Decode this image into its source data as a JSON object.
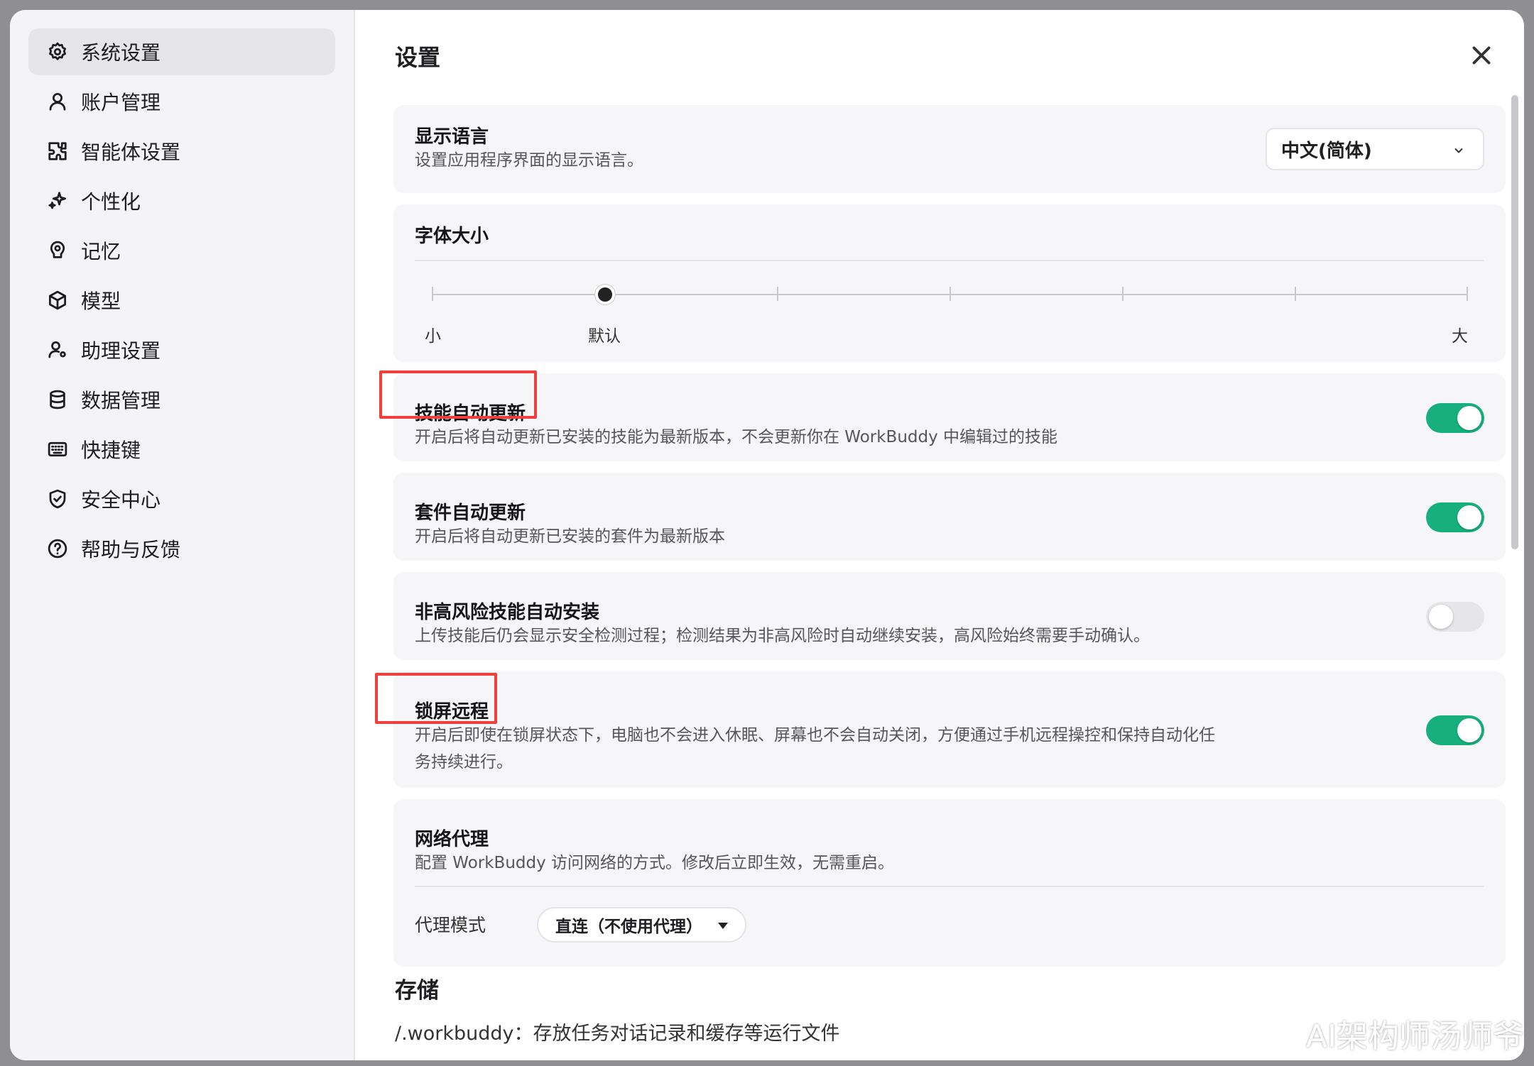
{
  "sidebar": {
    "items": [
      {
        "label": "系统设置",
        "icon": "gear-icon"
      },
      {
        "label": "账户管理",
        "icon": "user-icon"
      },
      {
        "label": "智能体设置",
        "icon": "puzzle-icon"
      },
      {
        "label": "个性化",
        "icon": "sparkle-icon"
      },
      {
        "label": "记忆",
        "icon": "memory-icon"
      },
      {
        "label": "模型",
        "icon": "cube-icon"
      },
      {
        "label": "助理设置",
        "icon": "user-gear-icon"
      },
      {
        "label": "数据管理",
        "icon": "database-icon"
      },
      {
        "label": "快捷键",
        "icon": "keyboard-icon"
      },
      {
        "label": "安全中心",
        "icon": "shield-icon"
      },
      {
        "label": "帮助与反馈",
        "icon": "help-icon"
      }
    ]
  },
  "main": {
    "title": "设置",
    "language": {
      "title": "显示语言",
      "desc": "设置应用程序界面的显示语言。",
      "value": "中文(简体)"
    },
    "font_size": {
      "title": "字体大小",
      "label_small": "小",
      "label_default": "默认",
      "label_large": "大",
      "level": 1,
      "steps": 7
    },
    "skill_update": {
      "title": "技能自动更新",
      "desc": "开启后将自动更新已安装的技能为最新版本，不会更新你在 WorkBuddy 中编辑过的技能",
      "enabled": true
    },
    "suite_update": {
      "title": "套件自动更新",
      "desc": "开启后将自动更新已安装的套件为最新版本",
      "enabled": true
    },
    "auto_install": {
      "title": "非高风险技能自动安装",
      "desc": "上传技能后仍会显示安全检测过程；检测结果为非高风险时自动继续安装，高风险始终需要手动确认。",
      "enabled": false
    },
    "lock_screen": {
      "title": "锁屏远程",
      "desc_line1": "开启后即使在锁屏状态下，电脑也不会进入休眠、屏幕也不会自动关闭，方便通过手机远程操控和保持自动化任",
      "desc_line2": "务持续进行。",
      "enabled": true
    },
    "proxy": {
      "title": "网络代理",
      "desc": "配置 WorkBuddy 访问网络的方式。修改后立即生效，无需重启。",
      "mode_label": "代理模式",
      "mode_value": "直连（不使用代理）"
    },
    "storage": {
      "title": "存储",
      "line": "/.workbuddy：存放任务对话记录和缓存等运行文件"
    }
  },
  "watermark": "AI架构师汤师爷",
  "colors": {
    "toggle_on": "#17b07c",
    "highlight": "#f0403c"
  }
}
